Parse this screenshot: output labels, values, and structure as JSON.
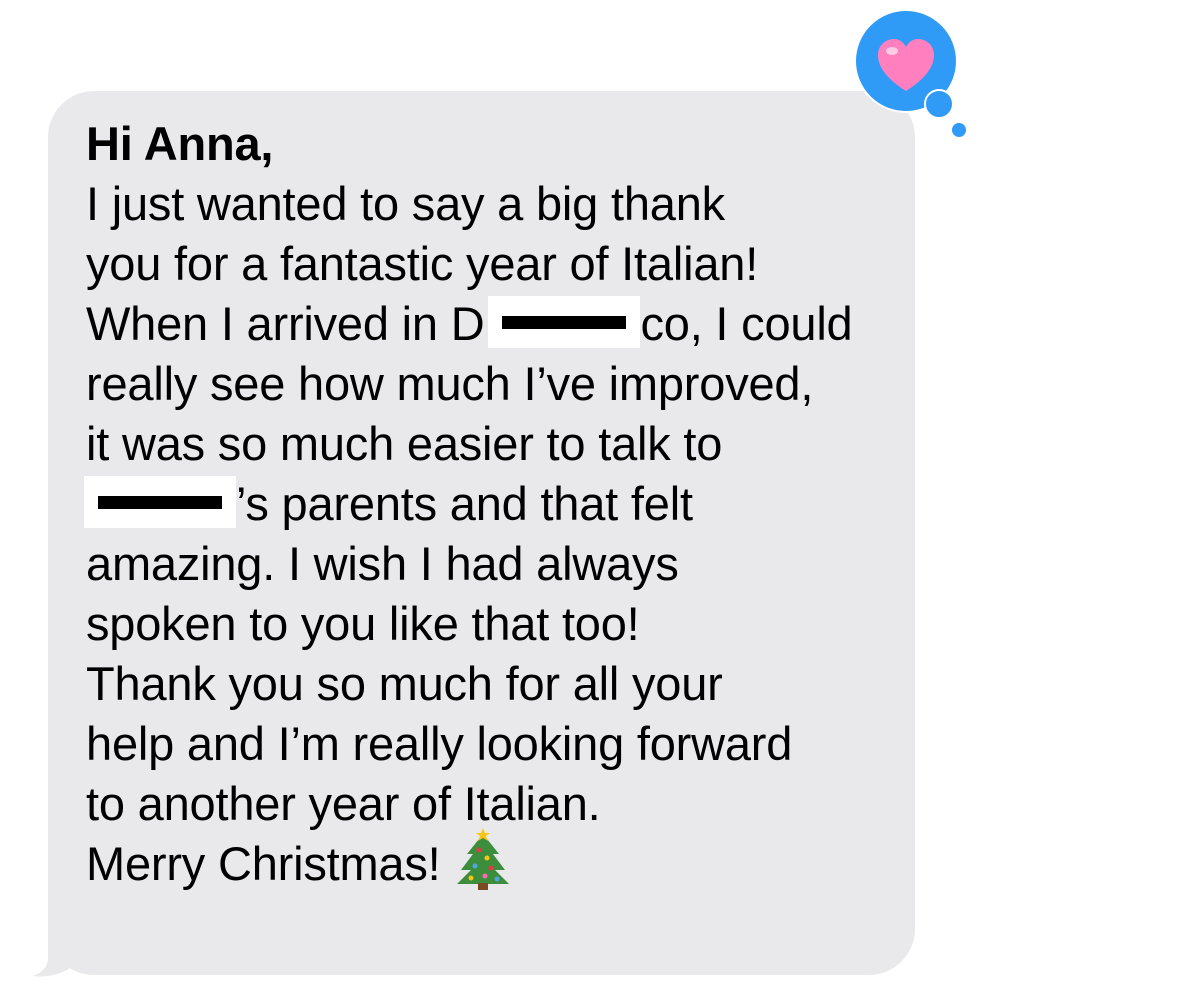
{
  "message": {
    "greeting": "Hi Anna,",
    "line1": "I just wanted to say a big thank",
    "line2": "you for a fantastic year of Italian!",
    "line3_pre": "When I arrived in D",
    "line3_post": "co, I could",
    "line4": "really see how much I’ve improved,",
    "line5": "it was so much easier to talk to",
    "line6_post": "’s parents and that felt",
    "line7": "amazing. I wish I had always",
    "line8": "spoken to you like that too!",
    "line9": "Thank you so much for all your",
    "line10": "help and I’m really looking forward",
    "line11": "to another year of Italian.",
    "line12": "Merry Christmas!",
    "emoji": "christmas-tree-icon"
  },
  "tapback": {
    "reaction": "heart-icon",
    "bubble_color": "#2f9bf7",
    "heart_color": "#ff7fbf"
  },
  "colors": {
    "bubble": "#e9e9eb",
    "text": "#000000",
    "background": "#ffffff"
  }
}
